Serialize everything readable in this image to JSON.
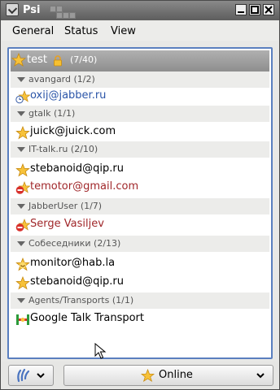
{
  "window": {
    "title": "Psi"
  },
  "menu": {
    "items": [
      "General",
      "Status",
      "View"
    ]
  },
  "roster": {
    "account": {
      "name": "test",
      "count": "(7/40)"
    },
    "groups": [
      {
        "name": "avangard",
        "count": "(1/2)",
        "contacts": [
          {
            "name": "oxij@jabber.ru",
            "color": "#2b55a8",
            "icon": "away-star-icon"
          }
        ]
      },
      {
        "name": "gtalk",
        "count": "(1/1)",
        "contacts": [
          {
            "name": "juick@juick.com",
            "color": "#000000",
            "icon": "online-star-icon"
          }
        ]
      },
      {
        "name": "IT-talk.ru",
        "count": "(2/10)",
        "contacts": [
          {
            "name": "stebanoid@qip.ru",
            "color": "#000000",
            "icon": "online-star-icon"
          },
          {
            "name": "temotor@gmail.com",
            "color": "#a0272a",
            "icon": "dnd-star-icon"
          }
        ]
      },
      {
        "name": "JabberUser",
        "count": "(1/7)",
        "contacts": [
          {
            "name": "Serge Vasiljev",
            "color": "#a0272a",
            "icon": "dnd-star-icon"
          }
        ]
      },
      {
        "name": "Собеседники",
        "count": "(2/13)",
        "contacts": [
          {
            "name": "monitor@hab.la",
            "color": "#000000",
            "icon": "chat-star-icon"
          },
          {
            "name": "stebanoid@qip.ru",
            "color": "#000000",
            "icon": "online-star-icon"
          }
        ]
      },
      {
        "name": "Agents/Transports",
        "count": "(1/1)",
        "contacts": [
          {
            "name": "Google Talk Transport",
            "color": "#000000",
            "icon": "transport-icon"
          }
        ]
      }
    ]
  },
  "bottom": {
    "status": "Online"
  }
}
